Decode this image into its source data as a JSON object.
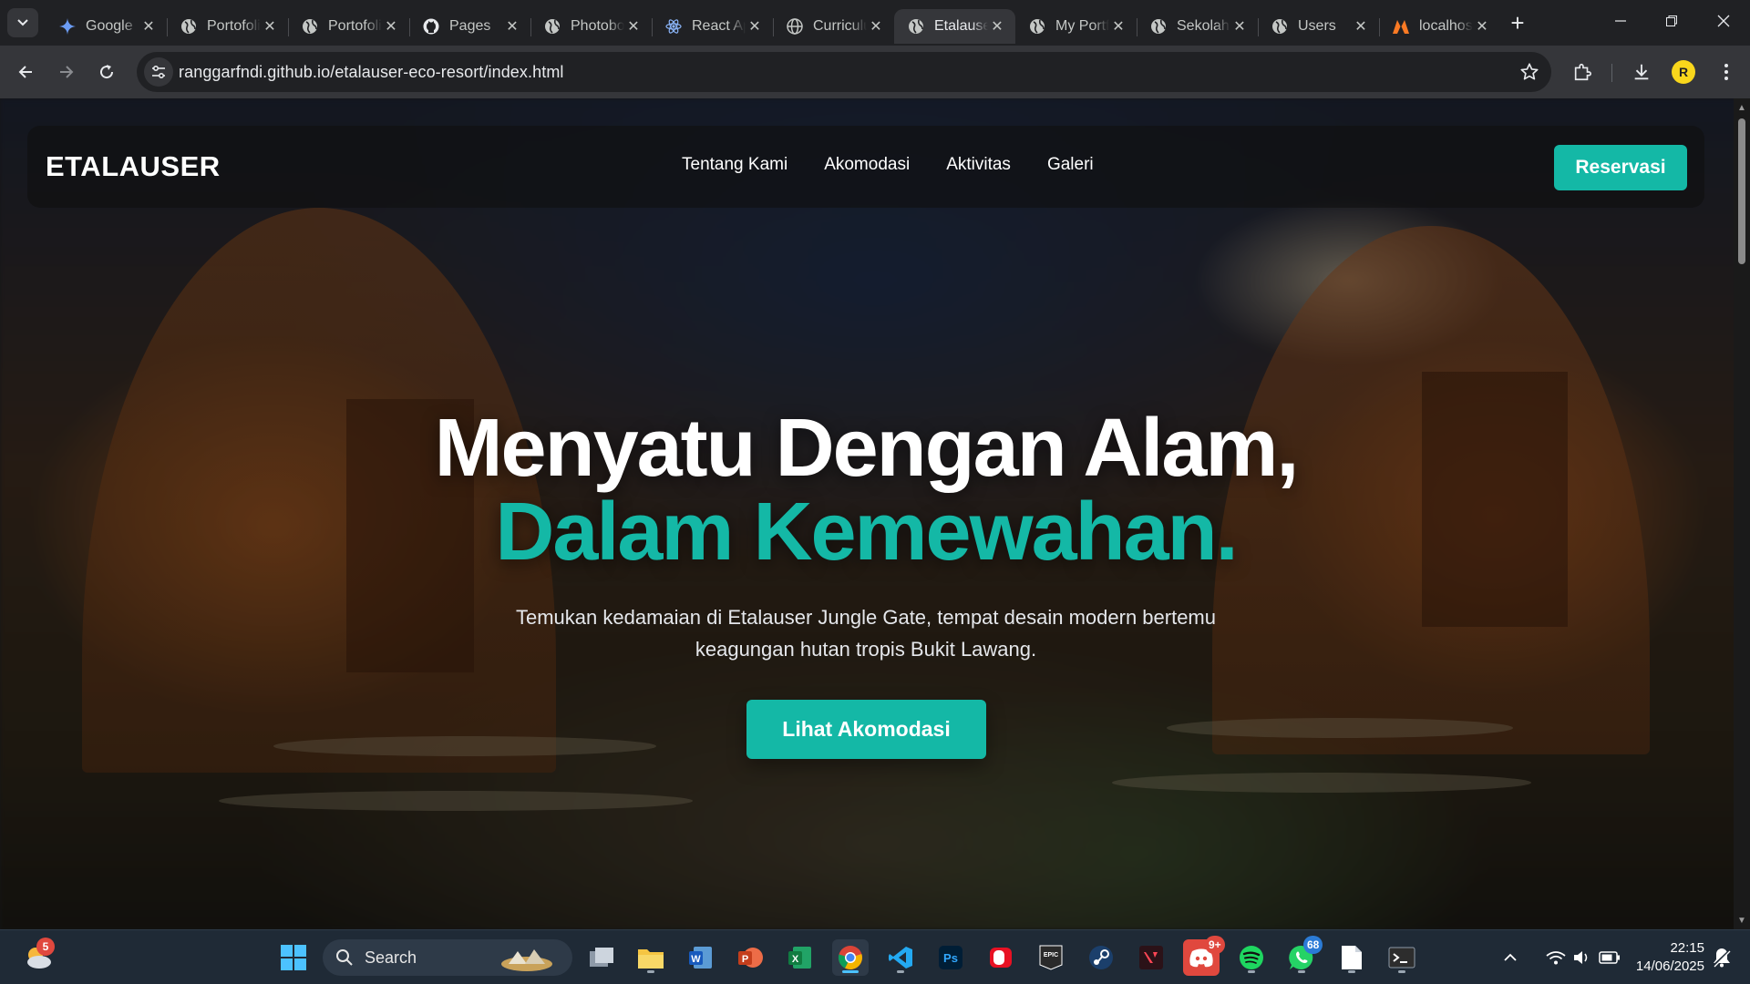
{
  "browser": {
    "tabs": [
      {
        "title": "Google",
        "icon": "gemini-icon",
        "active": false
      },
      {
        "title": "Portofolio",
        "icon": "globe-icon",
        "active": false
      },
      {
        "title": "Portofolio",
        "icon": "globe-icon",
        "active": false
      },
      {
        "title": "Pages",
        "icon": "github-icon",
        "active": false
      },
      {
        "title": "Photoboo",
        "icon": "globe-icon",
        "active": false
      },
      {
        "title": "React App",
        "icon": "react-icon",
        "active": false
      },
      {
        "title": "Curriculum",
        "icon": "web-icon",
        "active": false
      },
      {
        "title": "Etalauser",
        "icon": "globe-icon",
        "active": true
      },
      {
        "title": "My Portfolio",
        "icon": "globe-icon",
        "active": false
      },
      {
        "title": "Sekolah",
        "icon": "globe-icon",
        "active": false
      },
      {
        "title": "Users",
        "icon": "globe-icon",
        "active": false
      },
      {
        "title": "localhost",
        "icon": "xampp-icon",
        "active": false
      }
    ],
    "url": "ranggarfndi.github.io/etalauser-eco-resort/index.html",
    "profile_initial": "R"
  },
  "site": {
    "logo": "ETALAUSER",
    "nav": [
      "Tentang Kami",
      "Akomodasi",
      "Aktivitas",
      "Galeri"
    ],
    "reserve_label": "Reservasi",
    "hero_line1": "Menyatu Dengan Alam,",
    "hero_line2": "Dalam Kemewahan.",
    "hero_sub_line1": "Temukan kedamaian di Etalauser Jungle Gate, tempat desain modern bertemu",
    "hero_sub_line2": "keagungan hutan tropis Bukit Lawang.",
    "cta_label": "Lihat Akomodasi",
    "accent": "#14b8a6"
  },
  "taskbar": {
    "weather_badge": "5",
    "search_placeholder": "Search",
    "discord_badge": "9+",
    "whatsapp_badge": "68",
    "time": "22:15",
    "date": "14/06/2025"
  }
}
